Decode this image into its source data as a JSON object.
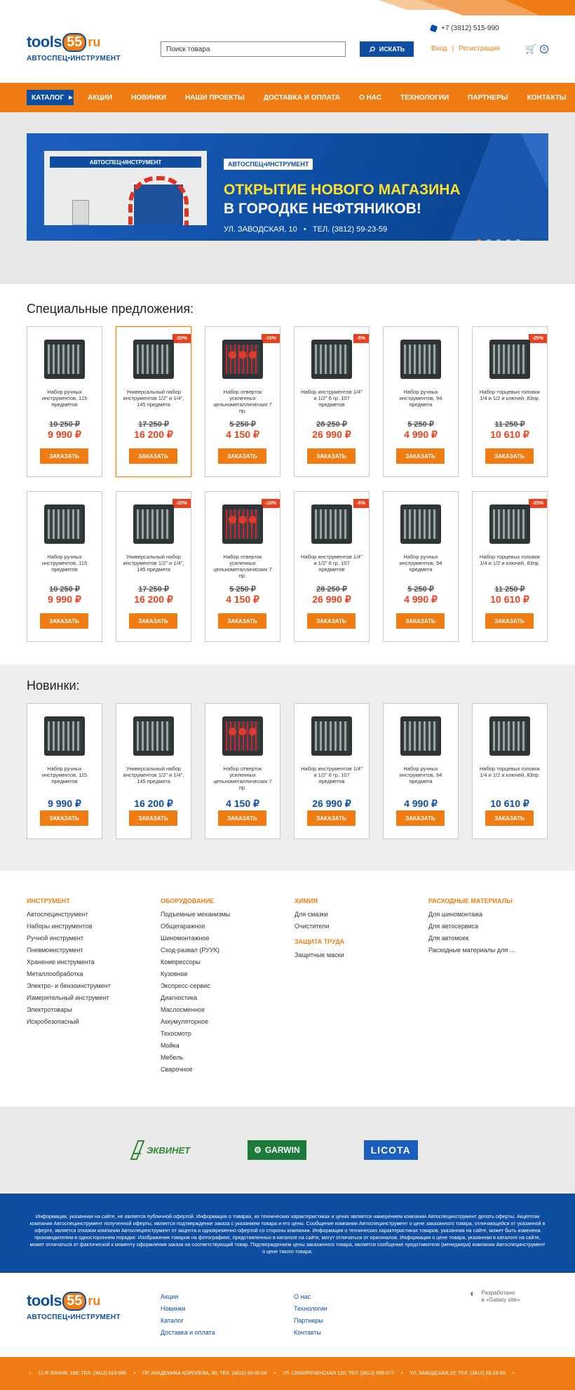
{
  "header": {
    "logo": {
      "tools": "tools",
      "num": "55",
      "ru": "ru",
      "sub": "АВТОСПЕЦ•ИНСТРУМЕНТ"
    },
    "phone": "+7 (3812) 515-990",
    "search_placeholder": "Поиск товара",
    "search_btn": "ИСКАТЬ",
    "login": "Вход",
    "register": "Регистрация",
    "cart_count": "0"
  },
  "nav": {
    "catalog": "КАТАЛОГ",
    "items": [
      "АКЦИИ",
      "НОВИНКИ",
      "НАШИ ПРОЕКТЫ",
      "ДОСТАВКА И ОПЛАТА",
      "О НАС",
      "ТЕХНОЛОГИИ",
      "ПАРТНЕРЫ",
      "КОНТАКТЫ"
    ]
  },
  "slider": {
    "sign": "АВТОСПЕЦ•ИНСТРУМЕНТ",
    "tag": "АВТОСПЕЦ•ИНСТРУМЕНТ",
    "title1": "ОТКРЫТИЕ НОВОГО МАГАЗИНА",
    "title2": "В ГОРОДКЕ НЕФТЯНИКОВ!",
    "address": "УЛ. ЗАВОДСКАЯ, 10",
    "bullet": "•",
    "phone": "ТЕЛ. (3812) 59-23-59"
  },
  "special": {
    "title": "Специальные предложения:",
    "order": "ЗАКАЗАТЬ",
    "products": [
      {
        "name": "Набор ручных инструментов, 115 предметов",
        "old": "10 250 ₽",
        "new": "9 990 ₽",
        "badge": ""
      },
      {
        "name": "Универсальный набор инструментов 1/2\" и 1/4\", 145 предмета",
        "old": "17 250 ₽",
        "new": "16 200 ₽",
        "badge": "-20%"
      },
      {
        "name": "Набор отверток усиленных цельнометаллических 7 пр.",
        "old": "5 250 ₽",
        "new": "4 150 ₽",
        "badge": "-10%"
      },
      {
        "name": "Набор инструментов 1/4\" и 1/2\" 6 гр. 107 предметов",
        "old": "28 250 ₽",
        "new": "26 990 ₽",
        "badge": "-5%"
      },
      {
        "name": "Набор ручных инструментов, 94 предмета",
        "old": "5 250 ₽",
        "new": "4 990 ₽",
        "badge": ""
      },
      {
        "name": "Набор торцевых головок 1/4 и 1/2 и ключей, 83пр.",
        "old": "11 250 ₽",
        "new": "10 610 ₽",
        "badge": "-25%"
      }
    ]
  },
  "new_items": {
    "title": "Новинки:",
    "order": "ЗАКАЗАТЬ",
    "products": [
      {
        "name": "Набор ручных инструментов, 115 предметов",
        "new": "9 990 ₽"
      },
      {
        "name": "Универсальный набор инструментов 1/2\" и 1/4\", 145 предмета",
        "new": "16 200 ₽"
      },
      {
        "name": "Набор отверток усиленных цельнометаллических 7 пр.",
        "new": "4 150 ₽"
      },
      {
        "name": "Набор инструментов 1/4\" и 1/2\" 6 гр. 107 предметов",
        "new": "26 990 ₽"
      },
      {
        "name": "Набор ручных инструментов, 94 предмета",
        "new": "4 990 ₽"
      },
      {
        "name": "Набор торцевых головок 1/4 и 1/2 и ключей, 83пр.",
        "new": "10 610 ₽"
      }
    ]
  },
  "catalog_footer": {
    "instrument": {
      "head": "ИНСТРУМЕНТ",
      "items": [
        "Автоспецинструмент",
        "Наборы инструментов",
        "Ручной инструмент",
        "Пневмоинструмент",
        "Хранение инструмента",
        "Металлообработка",
        "Электро- и бензоинструмент",
        "Измерительный инструмент",
        "Электротовары",
        "Искробезопасный"
      ]
    },
    "equipment": {
      "head": "ОБОРУДОВАНИЕ",
      "items": [
        "Подъемные механизмы",
        "Общегаражное",
        "Шиномонтажное",
        "Сход-развал (РУУК)",
        "Компрессоры",
        "Кузовное",
        "Экспресс-сервис",
        "Диагностика",
        "Маслосменное",
        "Аккумуляторное",
        "Техосмотр",
        "Мойка",
        "Мебель",
        "Сварочное"
      ]
    },
    "chemistry": {
      "head": "ХИМИЯ",
      "items": [
        "Для смазки",
        "Очистители"
      ]
    },
    "protection": {
      "head": "ЗАЩИТА ТРУДА",
      "items": [
        "Защитные маски"
      ]
    },
    "consumables": {
      "head": "РАСХОДНЫЕ МАТЕРИАЛЫ",
      "items": [
        "Для шиномонтажа",
        "Для автосервиса",
        "Для автомоек",
        "Расходные материалы для ..."
      ]
    }
  },
  "partners": {
    "p1": "ЭКВИНЕТ",
    "p2": "GARWIN",
    "p3": "LICOTA"
  },
  "disclaimer": "Информация, указанная на сайте, не является публичной офертой. Информация о товарах, их технических характеристиках и ценах является намерением компании Автоспецинструмент делать оферты. Акцептом компании Автоспецинструмент полученной оферты, является подтверждение заказа с указанием товара и его цены. Сообщение компании Автоспецинструмент о цене заказанного товара, отличающейся от указанной в оферте, является отказом компании Автоспецинструмент от акцепта и одновременно офертой со стороны компании. Информация о технических характеристиках товаров, указанная на сайте, может быть изменена производителем в одностороннем порядке. Изображения товаров на фотографиях, представленных в каталоге на сайте, могут отличаться от оригиналов. Информация о цене товара, указанная в каталоге на сайте, может отличаться от фактической к моменту оформления заказа на соответствующий товар. Подтверждением цены заказанного товара, является сообщение представителя (менеджера) компании Автоспецинструмент о цене такого товара.",
  "footer": {
    "col1": [
      "Акции",
      "Новинки",
      "Каталог",
      "Доставка и оплата"
    ],
    "col2": [
      "О нас",
      "Технологии",
      "Партнеры",
      "Контакты"
    ],
    "galaxy1": "Разработано",
    "galaxy2": "в «Galaxy site»"
  },
  "addresses": [
    "11-Я ЛИНИЯ, 185; ТЕЛ. (3812) 515-990",
    "ПР. АКАДЕМИКА КОРОЛЕВА, 30; ТЕЛ. (3812) 59-00-00",
    "УЛ. СЕМИРЕЧЕНСКАЯ 120; ТЕЛ. (3812) 599-077",
    "УЛ. ЗАВОДСКАЯ,10; ТЕЛ. (3812) 59-23-59"
  ],
  "colors": {
    "brand_blue": "#0d4ea3",
    "brand_orange": "#f07d13",
    "sale_red": "#e8411f"
  }
}
